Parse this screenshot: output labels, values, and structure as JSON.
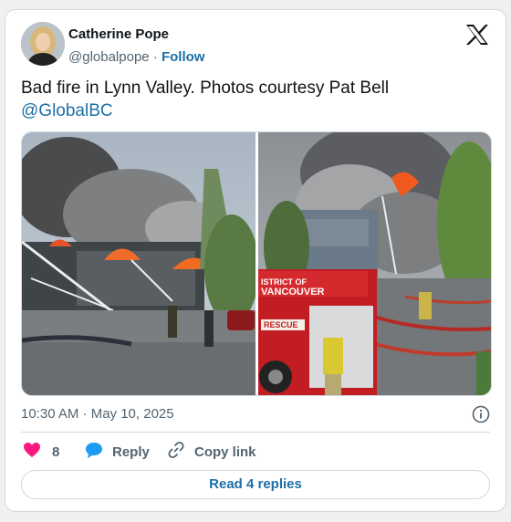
{
  "author": {
    "name": "Catherine Pope",
    "handle": "@globalpope",
    "separator": "·",
    "follow_label": "Follow"
  },
  "tweet": {
    "text": "Bad fire in Lynn Valley. Photos courtesy Pat Bell",
    "mention": "@GlobalBC"
  },
  "media": {
    "photos": [
      {
        "icon": "fire-photo-building"
      },
      {
        "icon": "fire-photo-truck",
        "truck_text": "ISTRICT OF VANCOUVER",
        "rescue_text": "RESCUE"
      }
    ]
  },
  "meta": {
    "timestamp": "10:30 AM · May 10, 2025"
  },
  "actions": {
    "like_count": "8",
    "reply_label": "Reply",
    "copy_label": "Copy link"
  },
  "replies_button": "Read 4 replies",
  "colors": {
    "link": "#1d6fa5",
    "like": "#f91880",
    "reply": "#1d9bf0",
    "text": "#0f1419",
    "muted": "#536471",
    "border": "#cfd9de"
  }
}
